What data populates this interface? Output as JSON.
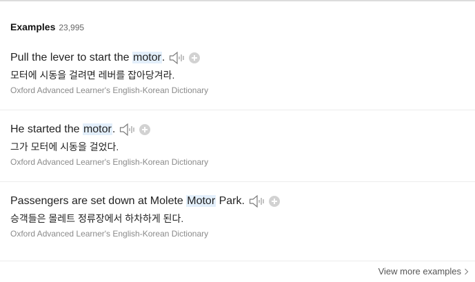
{
  "header": {
    "title": "Examples",
    "count": "23,995"
  },
  "examples": [
    {
      "pre": "Pull the lever to start the ",
      "keyword": "motor",
      "post": ".",
      "translation": "모터에 시동을 걸려면 레버를 잡아당겨라.",
      "source": "Oxford Advanced Learner's English-Korean Dictionary"
    },
    {
      "pre": "He started the ",
      "keyword": "motor",
      "post": ".",
      "translation": "그가 모터에 시동을 걸었다.",
      "source": "Oxford Advanced Learner's English-Korean Dictionary"
    },
    {
      "pre": "Passengers are set down at Molete ",
      "keyword": "Motor",
      "post": " Park.",
      "translation": "승객들은 몰레트 정류장에서 하차하게 된다.",
      "source": "Oxford Advanced Learner's English-Korean Dictionary"
    }
  ],
  "footer": {
    "view_more_label": "View more examples"
  },
  "icons": {
    "speaker": "speaker-icon",
    "add": "plus-icon",
    "chevron": "chevron-right-icon"
  },
  "colors": {
    "highlight": "#e3effb",
    "source_text": "#8a8a8a",
    "plus_button": "#d2d2d2"
  }
}
